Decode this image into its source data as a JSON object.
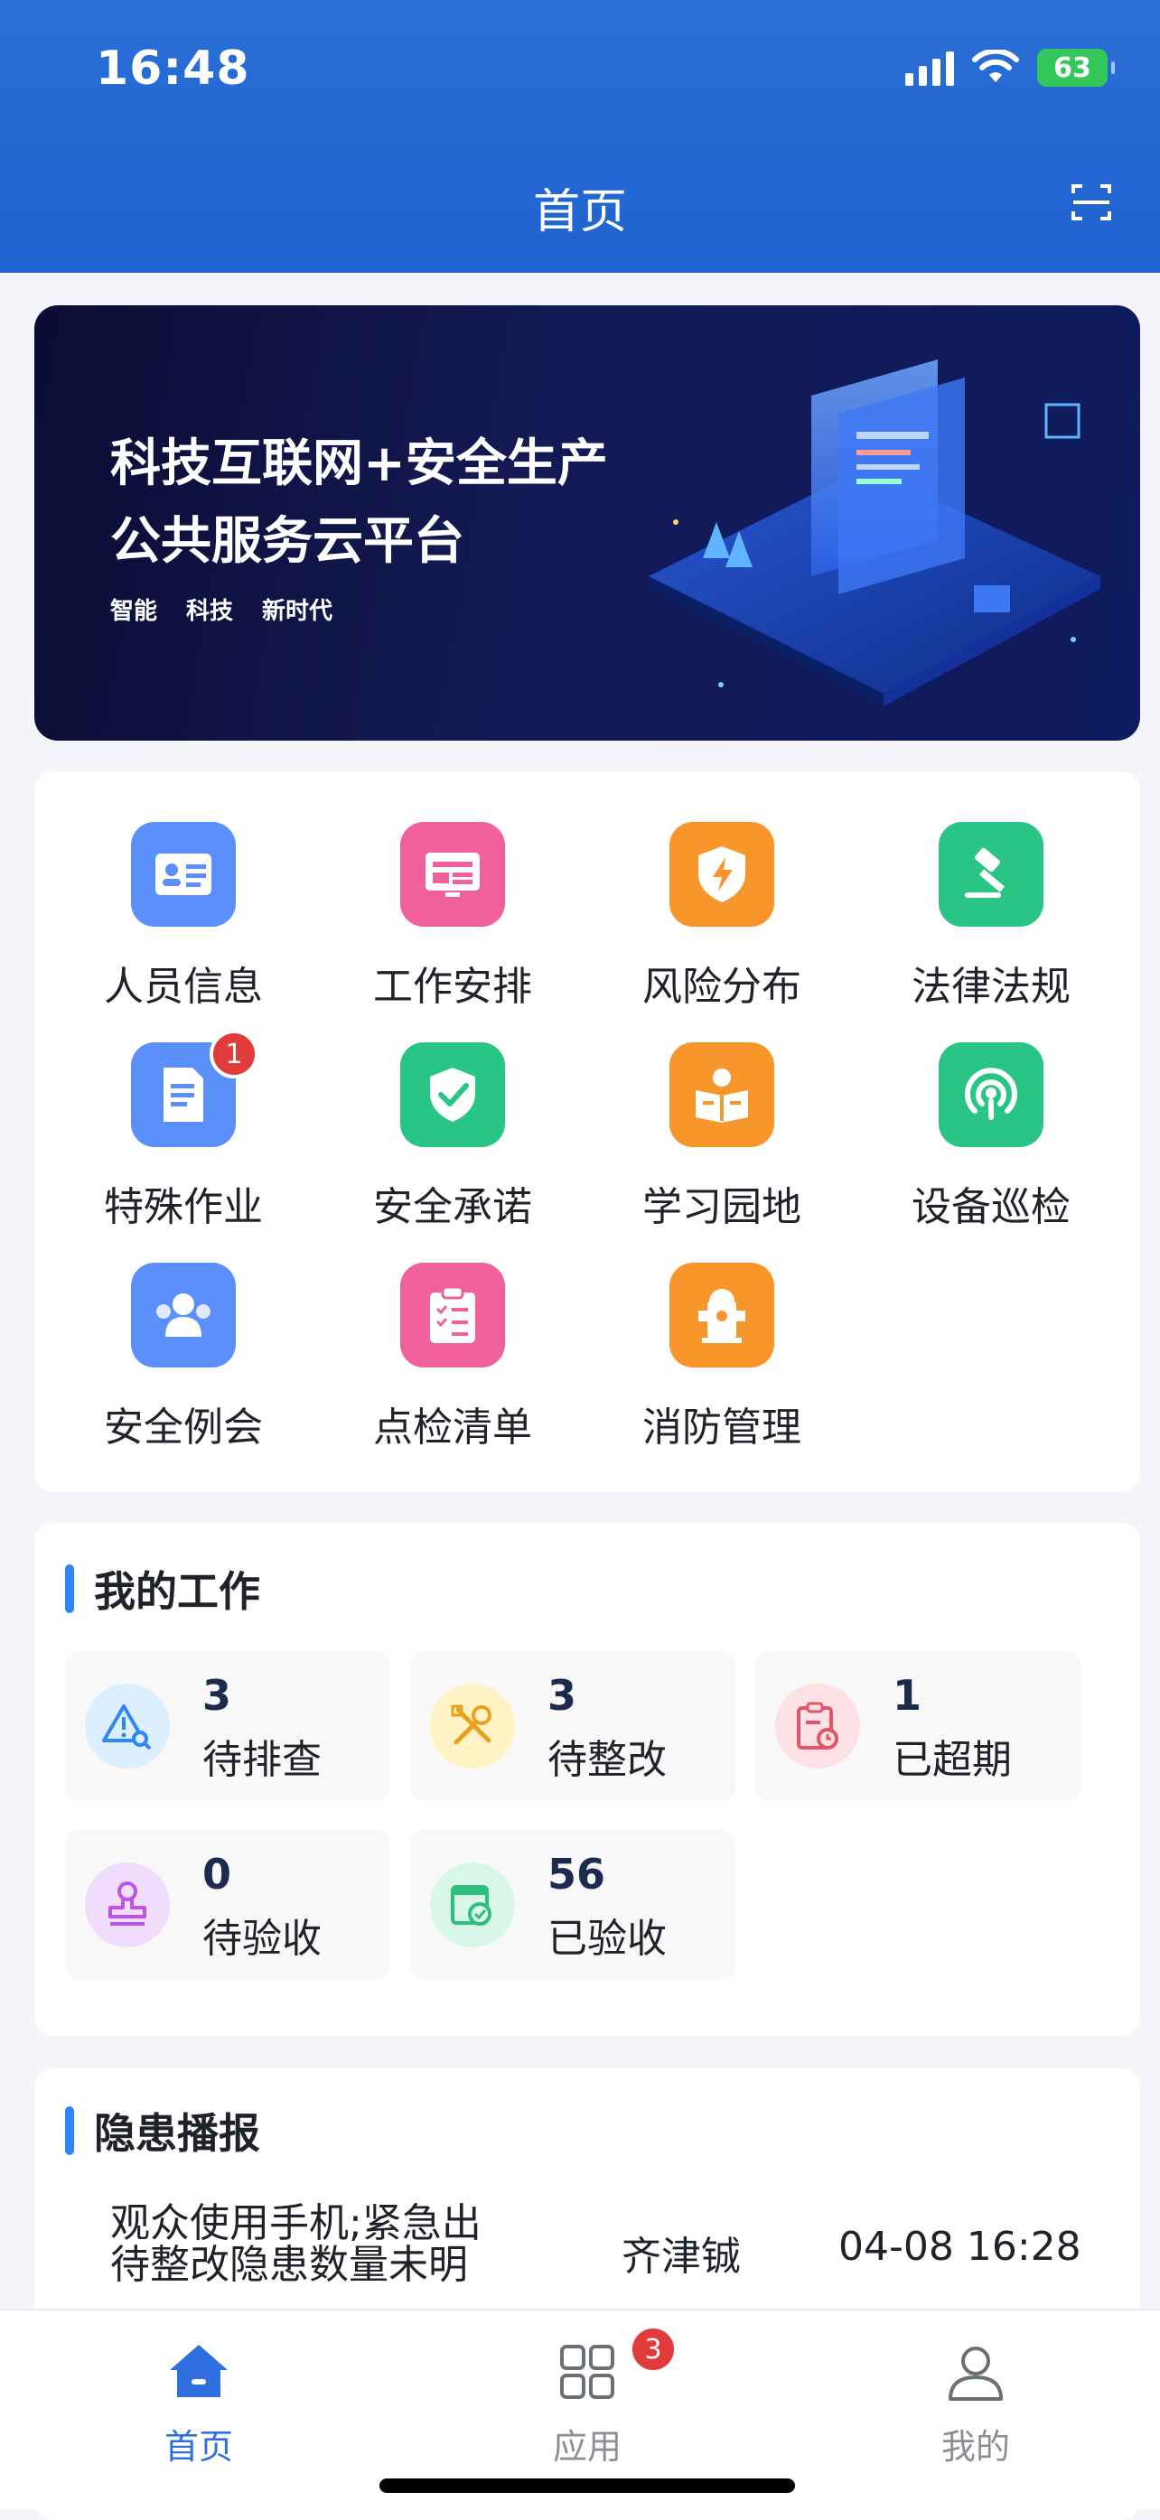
{
  "status_bar": {
    "time": "16:48",
    "battery": "63"
  },
  "header": {
    "title": "首页",
    "scan_icon": "scan-icon"
  },
  "banner": {
    "line1": "科技互联网+安全生产",
    "line2": "公共服务云平台",
    "tags": [
      "智能",
      "科技",
      "新时代"
    ]
  },
  "apps": [
    {
      "label": "人员信息",
      "icon": "id-card-icon",
      "color": "#5b8ff9"
    },
    {
      "label": "工作安排",
      "icon": "schedule-icon",
      "color": "#f0609a"
    },
    {
      "label": "风险分布",
      "icon": "shield-bolt-icon",
      "color": "#f7962b"
    },
    {
      "label": "法律法规",
      "icon": "gavel-icon",
      "color": "#28c585"
    },
    {
      "label": "特殊作业",
      "icon": "document-icon",
      "color": "#5b8ff9",
      "badge": "1"
    },
    {
      "label": "安全承诺",
      "icon": "shield-check-icon",
      "color": "#28c585"
    },
    {
      "label": "学习园地",
      "icon": "reading-icon",
      "color": "#f7962b"
    },
    {
      "label": "设备巡检",
      "icon": "signal-icon",
      "color": "#28c585"
    },
    {
      "label": "安全例会",
      "icon": "meeting-icon",
      "color": "#5b8ff9"
    },
    {
      "label": "点检清单",
      "icon": "checklist-icon",
      "color": "#f0609a"
    },
    {
      "label": "消防管理",
      "icon": "hydrant-icon",
      "color": "#f7962b"
    }
  ],
  "my_work": {
    "title": "我的工作",
    "items": [
      {
        "count": "3",
        "label": "待排查",
        "icon": "alert-search-icon",
        "bg": "#dcefff",
        "fg": "#2f86f6"
      },
      {
        "count": "3",
        "label": "待整改",
        "icon": "tools-icon",
        "bg": "#fff2c4",
        "fg": "#e9a21c"
      },
      {
        "count": "1",
        "label": "已超期",
        "icon": "overdue-icon",
        "bg": "#fde1e4",
        "fg": "#e2566a"
      },
      {
        "count": "0",
        "label": "待验收",
        "icon": "stamp-icon",
        "bg": "#f1dcfb",
        "fg": "#b857e6"
      },
      {
        "count": "56",
        "label": "已验收",
        "icon": "accepted-icon",
        "bg": "#d8f7e9",
        "fg": "#2fbf7d"
      }
    ]
  },
  "hazard": {
    "title": "隐患播报",
    "item": {
      "text": "观众使用手机;紧急出",
      "overflow_text": "待整改隐患数量未明",
      "name": "齐津铖",
      "time": "04-08 16:28"
    }
  },
  "tabbar": {
    "items": [
      {
        "label": "首页",
        "icon": "home-icon",
        "active": true
      },
      {
        "label": "应用",
        "icon": "apps-icon",
        "badge": "3"
      },
      {
        "label": "我的",
        "icon": "user-icon"
      }
    ]
  },
  "colors": {
    "primary": "#2a6fd6",
    "accent": "#2f86f6",
    "badge": "#e23b3b"
  }
}
